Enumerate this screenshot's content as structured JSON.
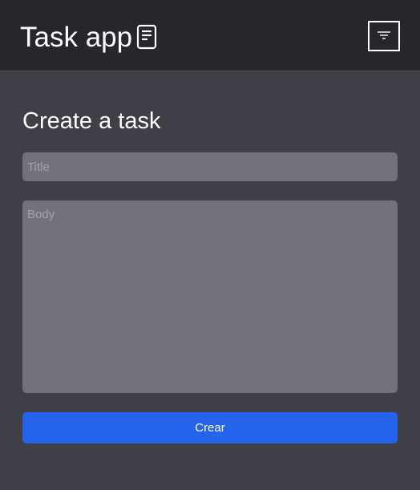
{
  "header": {
    "app_title": "Task app",
    "title_icon": "document-icon",
    "filter_icon": "filter-icon"
  },
  "form": {
    "heading": "Create a task",
    "title_placeholder": "Title",
    "title_value": "",
    "body_placeholder": "Body",
    "body_value": "",
    "submit_label": "Crear"
  },
  "colors": {
    "topbar": "#27272b",
    "background": "#3f4047",
    "input": "#71727b",
    "accent": "#2563eb"
  }
}
